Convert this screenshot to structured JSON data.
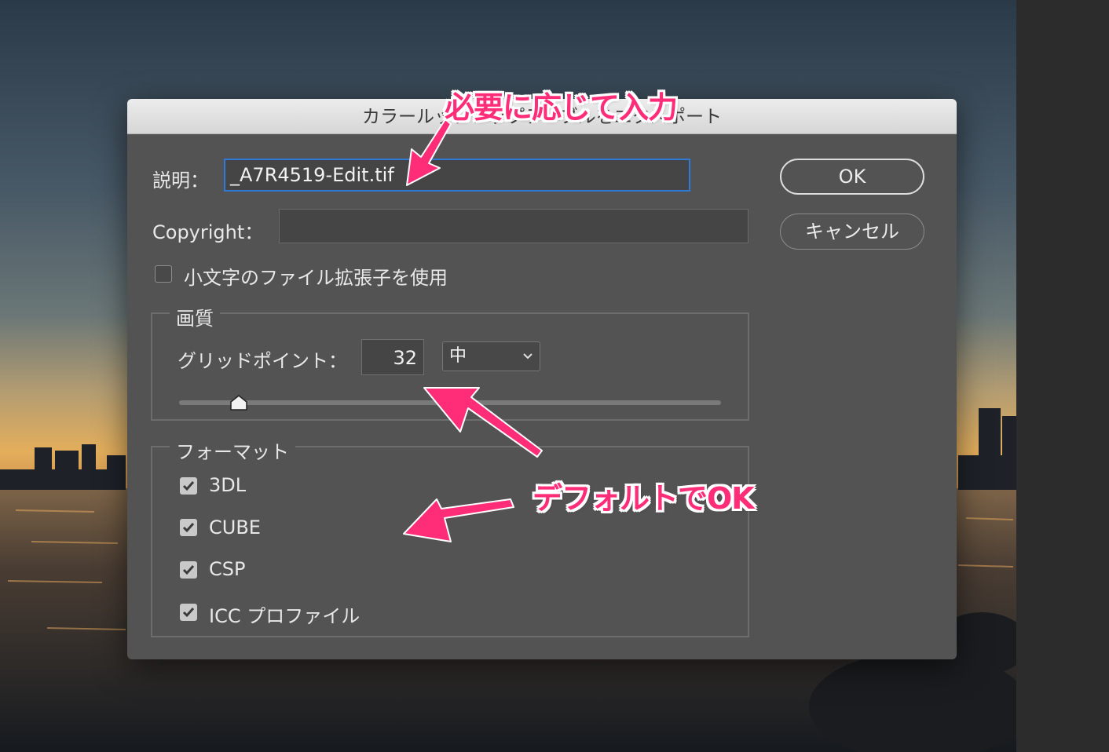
{
  "dialog": {
    "title": "カラールックアップテーブルをエクスポート",
    "description_label": "説明：",
    "description_value": "_A7R4519-Edit.tif",
    "copyright_label": "Copyright：",
    "copyright_value": "",
    "lowercase_ext_label": "小文字のファイル拡張子を使用",
    "lowercase_ext_checked": false,
    "ok_label": "OK",
    "cancel_label": "キャンセル"
  },
  "quality": {
    "group_label": "画質",
    "grid_points_label": "グリッドポイント：",
    "grid_points_value": "32",
    "quality_select_value": "中",
    "slider_value_fraction": 0.11
  },
  "format": {
    "group_label": "フォーマット",
    "options": [
      {
        "label": "3DL",
        "checked": true
      },
      {
        "label": "CUBE",
        "checked": true
      },
      {
        "label": "CSP",
        "checked": true
      },
      {
        "label": "ICC プロファイル",
        "checked": true
      }
    ]
  },
  "annotations": {
    "callout_top": "必要に応じて入力",
    "callout_middle": "デフォルトでOK",
    "color": "#ff2d78"
  },
  "colors": {
    "dialog_bg": "#535353",
    "focus_ring": "#2f7ad8"
  },
  "icons": {
    "checkbox_checked": "checkmark-icon",
    "select_arrow": "chevron-down-icon",
    "slider_thumb": "slider-thumb-icon",
    "arrow": "arrow-icon"
  }
}
